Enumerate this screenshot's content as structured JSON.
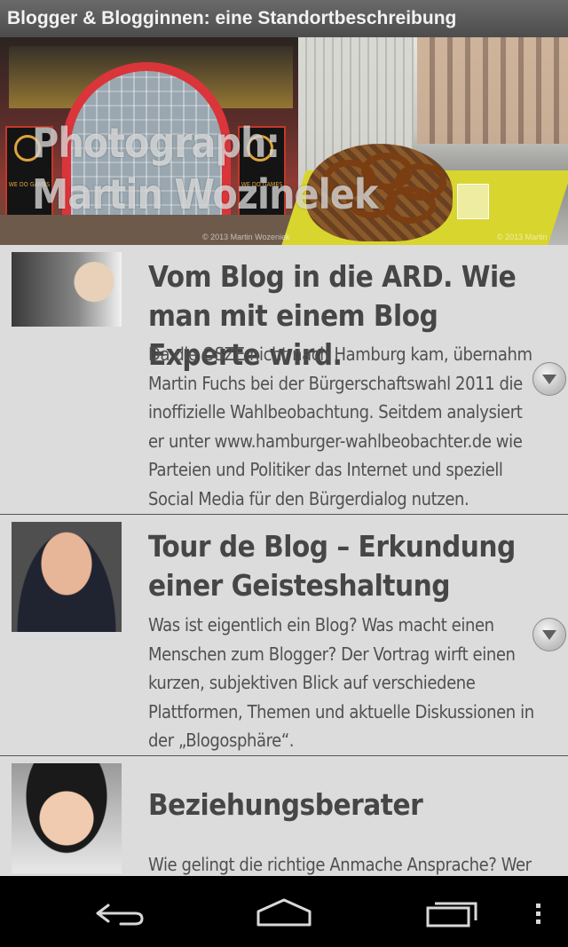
{
  "app": {
    "title": "Blogger & Blogginnen: eine Standortbeschreibung"
  },
  "hero": {
    "photo_credit_line1": "Photograph:",
    "photo_credit_line2": "Martin Wozinelek",
    "copyright_left": "© 2013 Martin Wozeniek",
    "copyright_right": "© 2013 Martin"
  },
  "sessions": [
    {
      "title": "Vom Blog in die ARD. Wie man mit einem Blog Experte wird.",
      "description": "Da die OSZE nicht nach Hamburg kam, übernahm Martin Fuchs bei der Bürgerschaftswahl 2011 die inoffizielle Wahlbeobachtung. Seitdem analysiert er unter www.hamburger-wahlbeobachter.de wie Parteien und Politiker das Internet und speziell Social Media für den Bürgerdialog nutzen."
    },
    {
      "title": "Tour de Blog – Erkundung einer Geisteshaltung",
      "description": "Was ist eigentlich ein Blog? Was macht einen Menschen zum Blogger? Der Vortrag wirft einen kurzen, subjektiven Blick auf verschiedene Plattformen, Themen und aktuelle Diskussionen in der „Blogosphäre“."
    },
    {
      "title": "Beziehungsberater",
      "description": "Wie gelingt die richtige Anmache Ansprache? Wer"
    }
  ],
  "icons": {
    "expand": "chevron-down-icon",
    "back": "back-icon",
    "home": "home-icon",
    "recents": "recent-apps-icon",
    "menu": "overflow-menu-icon"
  }
}
